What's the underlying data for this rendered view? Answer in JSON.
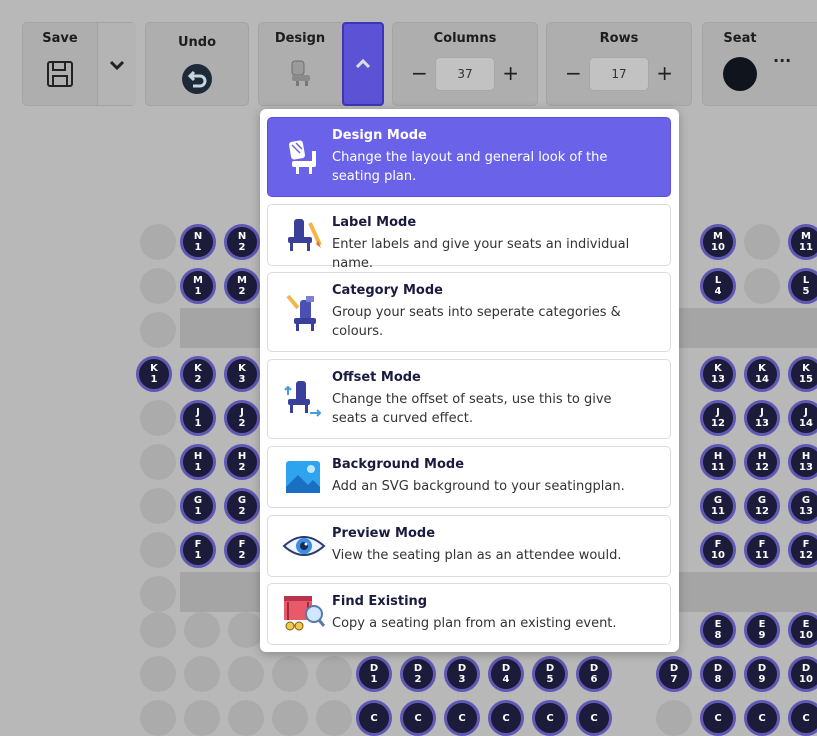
{
  "toolbar": {
    "save_label": "Save",
    "undo_label": "Undo",
    "design_label": "Design",
    "columns_label": "Columns",
    "columns_value": "37",
    "rows_label": "Rows",
    "rows_value": "17",
    "seat_label": "Seat",
    "minus": "−",
    "plus": "+",
    "more": "···"
  },
  "menu": {
    "items": [
      {
        "title": "Design Mode",
        "desc": "Change the layout and general look of the seating plan.",
        "active": true
      },
      {
        "title": "Label Mode",
        "desc": "Enter labels and give your seats an individual name."
      },
      {
        "title": "Category Mode",
        "desc": "Group your seats into seperate categories & colours."
      },
      {
        "title": "Offset Mode",
        "desc": "Change the offset of seats, use this to give seats a curved effect."
      },
      {
        "title": "Background Mode",
        "desc": "Add an SVG background to your seatingplan."
      },
      {
        "title": "Preview Mode",
        "desc": "View the seating plan as an attendee would."
      },
      {
        "title": "Find Existing",
        "desc": "Copy a seating plan from an existing event."
      }
    ]
  },
  "seats": {
    "left": [
      {
        "row": "N",
        "nums": [
          "1",
          "2"
        ]
      },
      {
        "row": "M",
        "nums": [
          "1",
          "2"
        ]
      },
      {
        "row": "K",
        "nums": [
          "1",
          "2",
          "3"
        ]
      },
      {
        "row": "J",
        "nums": [
          "1",
          "2"
        ]
      },
      {
        "row": "H",
        "nums": [
          "1",
          "2"
        ]
      },
      {
        "row": "G",
        "nums": [
          "1",
          "2"
        ]
      },
      {
        "row": "F",
        "nums": [
          "1",
          "2"
        ]
      }
    ],
    "right": [
      {
        "row": "M",
        "nums": [
          "10",
          "11"
        ]
      },
      {
        "row": "L",
        "nums": [
          "4",
          "5"
        ]
      },
      {
        "row": "K",
        "nums": [
          "13",
          "14",
          "15"
        ]
      },
      {
        "row": "J",
        "nums": [
          "12",
          "13",
          "14"
        ]
      },
      {
        "row": "H",
        "nums": [
          "11",
          "12",
          "13"
        ]
      },
      {
        "row": "G",
        "nums": [
          "11",
          "12",
          "13"
        ]
      },
      {
        "row": "F",
        "nums": [
          "10",
          "11",
          "12"
        ]
      },
      {
        "row": "E",
        "nums": [
          "8",
          "9",
          "10"
        ]
      },
      {
        "row": "D",
        "nums": [
          "7",
          "8",
          "9",
          "10"
        ]
      }
    ],
    "bottom_d": {
      "row": "D",
      "nums": [
        "1",
        "2",
        "3",
        "4",
        "5",
        "6"
      ]
    },
    "bottom_c": {
      "row": "C",
      "nums": [
        "",
        "",
        "",
        "",
        "",
        "",
        "",
        "",
        ""
      ]
    }
  },
  "colors": {
    "accent": "#6a63ea",
    "seat": "#1c1c3a",
    "seat_border": "#5f58b4"
  },
  "icons": [
    "save-icon",
    "chevron-down-icon",
    "undo-icon",
    "design-seat-icon",
    "chevron-up-icon",
    "seat-dot-icon"
  ]
}
